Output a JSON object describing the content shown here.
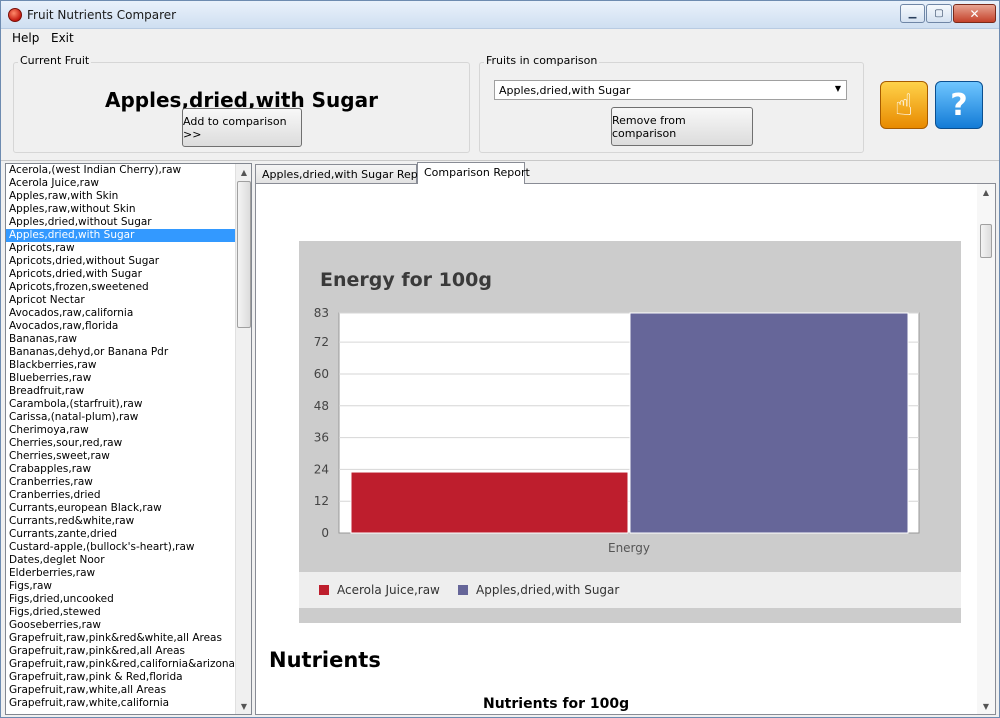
{
  "window": {
    "title": "Fruit Nutrients Comparer"
  },
  "menu": {
    "help": "Help",
    "exit": "Exit"
  },
  "current_fruit": {
    "label": "Current Fruit",
    "name": "Apples,dried,with Sugar",
    "add_button": "Add to comparison >>"
  },
  "comparison": {
    "label": "Fruits in comparison",
    "selected": "Apples,dried,with Sugar",
    "remove_button": "Remove from comparison"
  },
  "icons": {
    "hand": "pointer-hand-icon",
    "help": "help-question-icon"
  },
  "fruits": [
    "Acerola,(west Indian Cherry),raw",
    "Acerola Juice,raw",
    "Apples,raw,with Skin",
    "Apples,raw,without Skin",
    "Apples,dried,without Sugar",
    "Apples,dried,with Sugar",
    "Apricots,raw",
    "Apricots,dried,without Sugar",
    "Apricots,dried,with Sugar",
    "Apricots,frozen,sweetened",
    "Apricot Nectar",
    "Avocados,raw,california",
    "Avocados,raw,florida",
    "Bananas,raw",
    "Bananas,dehyd,or Banana Pdr",
    "Blackberries,raw",
    "Blueberries,raw",
    "Breadfruit,raw",
    "Carambola,(starfruit),raw",
    "Carissa,(natal-plum),raw",
    "Cherimoya,raw",
    "Cherries,sour,red,raw",
    "Cherries,sweet,raw",
    "Crabapples,raw",
    "Cranberries,raw",
    "Cranberries,dried",
    "Currants,european Black,raw",
    "Currants,red&white,raw",
    "Currants,zante,dried",
    "Custard-apple,(bullock's-heart),raw",
    "Dates,deglet Noor",
    "Elderberries,raw",
    "Figs,raw",
    "Figs,dried,uncooked",
    "Figs,dried,stewed",
    "Gooseberries,raw",
    "Grapefruit,raw,pink&red&white,all Areas",
    "Grapefruit,raw,pink&red,all Areas",
    "Grapefruit,raw,pink&red,california&arizona",
    "Grapefruit,raw,pink & Red,florida",
    "Grapefruit,raw,white,all Areas",
    "Grapefruit,raw,white,california"
  ],
  "selected_index": 5,
  "tabs": {
    "report": "Apples,dried,with Sugar Report",
    "comparison": "Comparison Report"
  },
  "chart_data": {
    "type": "bar",
    "title": "Energy for 100g",
    "categories": [
      "Energy"
    ],
    "series": [
      {
        "name": "Acerola Juice,raw",
        "values": [
          23
        ],
        "color": "#be1e2d"
      },
      {
        "name": "Apples,dried,with Sugar",
        "values": [
          83
        ],
        "color": "#666699"
      }
    ],
    "yticks": [
      0,
      12,
      24,
      36,
      48,
      60,
      72,
      83
    ],
    "ylim": [
      0,
      83
    ],
    "grid": true,
    "legend": "bottom"
  },
  "report": {
    "nutrients_heading": "Nutrients",
    "nutrients_subheading": "Nutrients for 100g"
  }
}
